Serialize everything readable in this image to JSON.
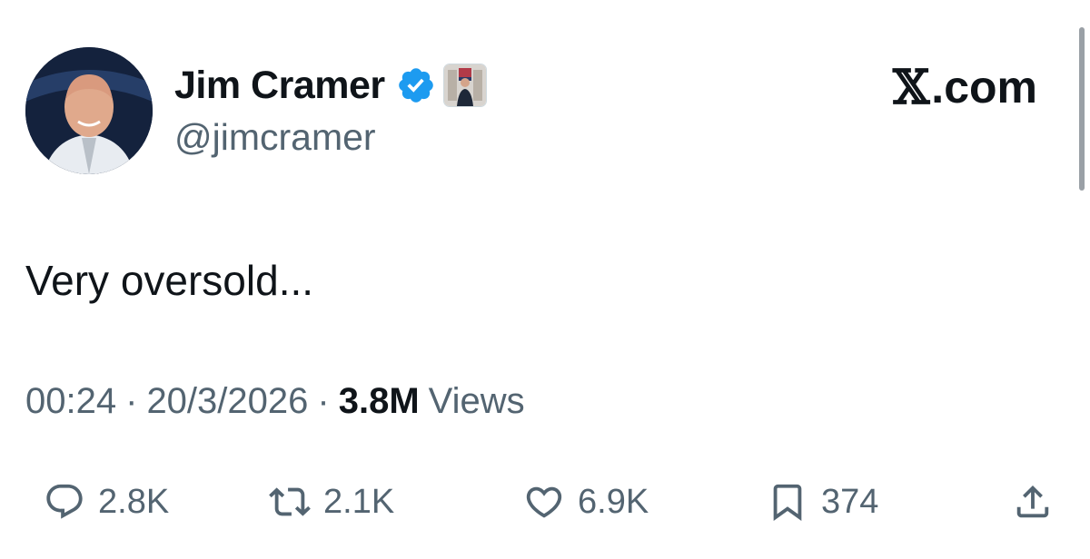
{
  "author": {
    "display_name": "Jim Cramer",
    "handle": "@jimcramer",
    "verified_icon": "verified-badge-icon",
    "verified_color": "#1d9bf0",
    "affiliation_icon": "affiliation-badge"
  },
  "brand": {
    "logo_glyph": "𝕏",
    "domain": ".com"
  },
  "tweet": {
    "text": "Very oversold...",
    "time": "00:24",
    "date": "20/3/2026",
    "views_count": "3.8M",
    "views_label": "Views",
    "separator": "·"
  },
  "actions": {
    "reply": {
      "icon": "reply-icon",
      "count": "2.8K"
    },
    "retweet": {
      "icon": "retweet-icon",
      "count": "2.1K"
    },
    "like": {
      "icon": "heart-icon",
      "count": "6.9K"
    },
    "bookmark": {
      "icon": "bookmark-icon",
      "count": "374"
    },
    "share": {
      "icon": "share-icon"
    }
  },
  "colors": {
    "text_primary": "#0f1419",
    "text_secondary": "#536471"
  }
}
